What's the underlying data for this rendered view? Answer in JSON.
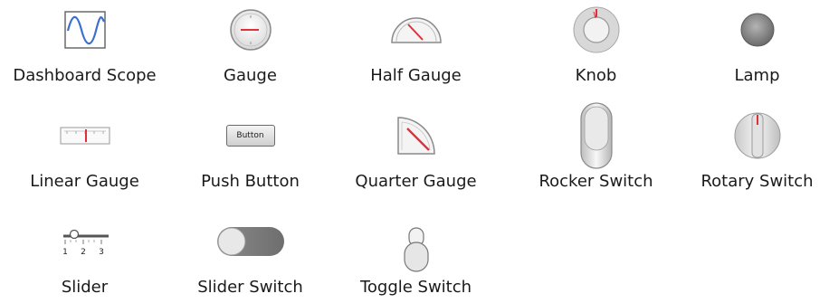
{
  "palette": {
    "items": [
      {
        "label": "Dashboard Scope",
        "icon": "dashboard-scope-icon"
      },
      {
        "label": "Gauge",
        "icon": "gauge-icon"
      },
      {
        "label": "Half Gauge",
        "icon": "half-gauge-icon"
      },
      {
        "label": "Knob",
        "icon": "knob-icon"
      },
      {
        "label": "Lamp",
        "icon": "lamp-icon"
      },
      {
        "label": "Linear Gauge",
        "icon": "linear-gauge-icon"
      },
      {
        "label": "Push Button",
        "icon": "push-button-icon",
        "button_text": "Button"
      },
      {
        "label": "Quarter Gauge",
        "icon": "quarter-gauge-icon"
      },
      {
        "label": "Rocker Switch",
        "icon": "rocker-switch-icon"
      },
      {
        "label": "Rotary Switch",
        "icon": "rotary-switch-icon"
      },
      {
        "label": "Slider",
        "icon": "slider-icon",
        "ticks": [
          "1",
          "2",
          "3"
        ]
      },
      {
        "label": "Slider Switch",
        "icon": "slider-switch-icon"
      },
      {
        "label": "Toggle Switch",
        "icon": "toggle-switch-icon"
      }
    ]
  },
  "colors": {
    "needle": "#e0303a",
    "scope_line": "#3a6fd0",
    "bezel": "#8a8a8a"
  }
}
